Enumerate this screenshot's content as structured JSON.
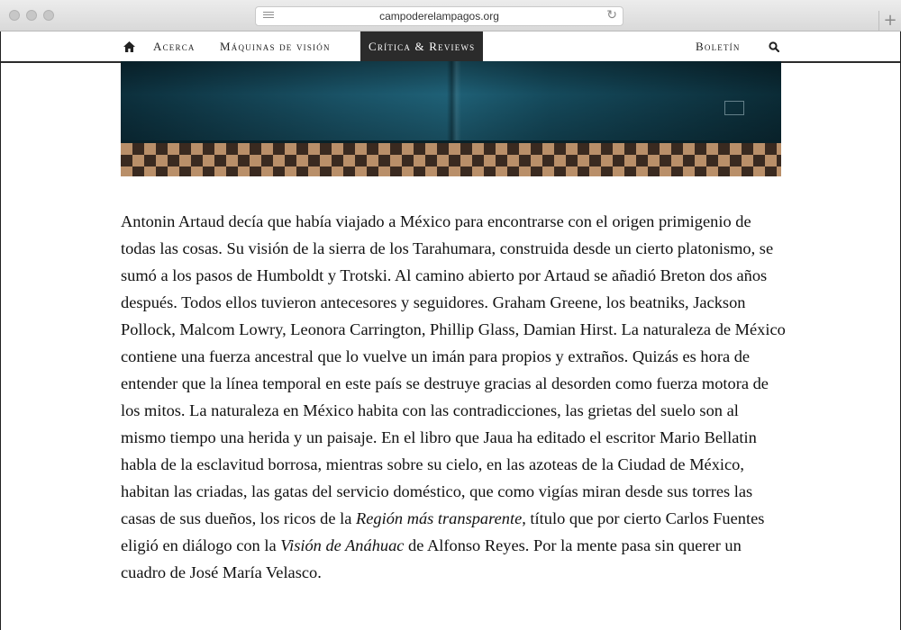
{
  "browser": {
    "url": "campoderelampagos.org"
  },
  "nav": {
    "items": [
      {
        "label": "Acerca"
      },
      {
        "label": "Máquinas de visión"
      },
      {
        "label": "Crítica & Reviews"
      }
    ],
    "right": {
      "label": "Boletín"
    }
  },
  "article": {
    "s1": "Antonin Artaud decía que había viajado a México para encontrarse con el origen primigenio de todas las cosas. Su visión de la sierra de los Tarahumara, construida desde un cierto platonismo, se sumó a los pasos de Humboldt y Trotski. Al camino abierto por Artaud se añadió Breton dos años después. Todos ellos tuvieron antecesores y seguidores. Graham Greene, los beatniks, Jackson Pollock, Malcom Lowry, Leonora Carrington, Phillip Glass, Damian Hirst. La naturaleza de México contiene una fuerza ancestral que lo vuelve un imán para propios y extraños. Quizás es hora de entender que la línea temporal en este país se destruye gracias al desorden como fuerza motora de los mitos. La naturaleza en México habita con las contradicciones, las grietas del suelo son al mismo tiempo una herida y un paisaje. En el libro que Jaua ha editado el escritor Mario Bellatin habla de la esclavitud borrosa, mientras sobre su cielo, en las azoteas de la Ciudad de México, habitan las criadas, las gatas del servicio doméstico, que como vigías miran desde sus torres las casas de sus dueños, los ricos de la ",
    "em1": "Región más transparente",
    "s2": ", título que por cierto Carlos Fuentes eligió en diálogo con la ",
    "em2": "Visión de Anáhuac",
    "s3": " de Alfonso Reyes. Por la mente pasa sin querer un cuadro de José María Velasco."
  }
}
